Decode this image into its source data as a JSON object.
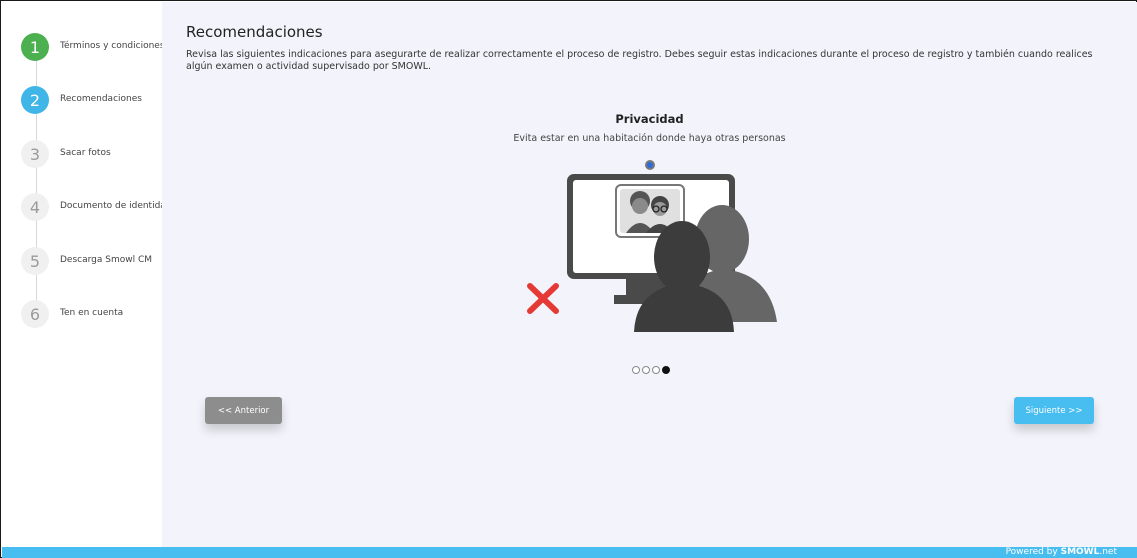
{
  "sidebar": {
    "steps": [
      {
        "number": "1",
        "label": "Términos y condiciones"
      },
      {
        "number": "2",
        "label": "Recomendaciones"
      },
      {
        "number": "3",
        "label": "Sacar fotos"
      },
      {
        "number": "4",
        "label": "Documento de identidad"
      },
      {
        "number": "5",
        "label": "Descarga Smowl CM"
      },
      {
        "number": "6",
        "label": "Ten en cuenta"
      }
    ]
  },
  "main": {
    "title": "Recomendaciones",
    "intro": "Revisa las siguientes indicaciones para asegurarte de realizar correctamente el proceso de registro. Debes seguir estas indicaciones durante el proceso de registro y también cuando realices algún examen o actividad supervisado por SMOWL.",
    "slide": {
      "title": "Privacidad",
      "subtitle": "Evita estar en una habitación donde haya otras personas",
      "icon": "no-other-people-illustration"
    },
    "carousel": {
      "total": 4,
      "current": 4
    },
    "buttons": {
      "prev_label": "<< Anterior",
      "next_label": "Siguiente >>"
    }
  },
  "footer": {
    "prefix": "Powered by ",
    "brand": "SMOWL",
    "suffix": ".net"
  },
  "colors": {
    "done": "#4caf50",
    "active": "#3fb5e8",
    "accent": "#47bdf0",
    "cross": "#e53935"
  }
}
